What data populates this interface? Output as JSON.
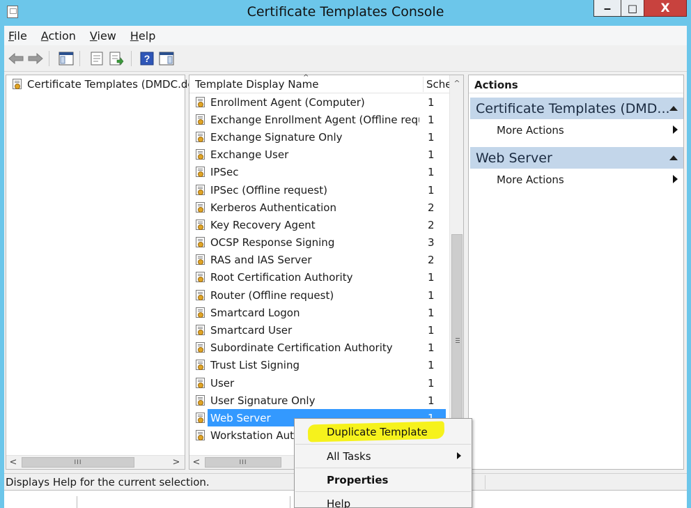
{
  "window": {
    "title": "Certificate Templates Console",
    "minimize_glyph": "‒",
    "maximize_glyph": "□",
    "close_glyph": "X"
  },
  "menubar": {
    "items": [
      {
        "first": "F",
        "rest": "ile"
      },
      {
        "first": "A",
        "rest": "ction"
      },
      {
        "first": "V",
        "rest": "iew"
      },
      {
        "first": "H",
        "rest": "elp"
      }
    ]
  },
  "toolbar": {
    "icons": [
      "back-arrow-icon",
      "forward-arrow-icon",
      "show-hide-console-tree-icon",
      "properties-icon",
      "export-list-icon",
      "help-icon",
      "show-hide-action-pane-icon"
    ],
    "colors": {
      "arrow": "#8c8c8c",
      "accent": "#2a4f8e",
      "help": "#2f56b8"
    }
  },
  "tree": {
    "root_label": "Certificate Templates (DMDC.de"
  },
  "list": {
    "columns": {
      "name": "Template Display Name",
      "schema": "Sche"
    },
    "rows": [
      {
        "name": "Enrollment Agent (Computer)",
        "schema": "1"
      },
      {
        "name": "Exchange Enrollment Agent (Offline requ...",
        "schema": "1"
      },
      {
        "name": "Exchange Signature Only",
        "schema": "1"
      },
      {
        "name": "Exchange User",
        "schema": "1"
      },
      {
        "name": "IPSec",
        "schema": "1"
      },
      {
        "name": "IPSec (Offline request)",
        "schema": "1"
      },
      {
        "name": "Kerberos Authentication",
        "schema": "2"
      },
      {
        "name": "Key Recovery Agent",
        "schema": "2"
      },
      {
        "name": "OCSP Response Signing",
        "schema": "3"
      },
      {
        "name": "RAS and IAS Server",
        "schema": "2"
      },
      {
        "name": "Root Certification Authority",
        "schema": "1"
      },
      {
        "name": "Router (Offline request)",
        "schema": "1"
      },
      {
        "name": "Smartcard Logon",
        "schema": "1"
      },
      {
        "name": "Smartcard User",
        "schema": "1"
      },
      {
        "name": "Subordinate Certification Authority",
        "schema": "1"
      },
      {
        "name": "Trust List Signing",
        "schema": "1"
      },
      {
        "name": "User",
        "schema": "1"
      },
      {
        "name": "User Signature Only",
        "schema": "1"
      },
      {
        "name": "Web Server",
        "schema": "1",
        "selected": true
      },
      {
        "name": "Workstation Auth",
        "schema": ""
      }
    ],
    "selection_color": "#3399ff"
  },
  "actions": {
    "title": "Actions",
    "sections": [
      {
        "header": "Certificate Templates (DMD...",
        "link": "More Actions"
      },
      {
        "header": "Web Server",
        "link": "More Actions"
      }
    ],
    "section_color": "#c3d6ea"
  },
  "status": {
    "text": "Displays Help for the current selection."
  },
  "context_menu": {
    "items": [
      {
        "label": "Duplicate Template",
        "highlighted": true
      },
      {
        "label": "All Tasks",
        "submenu": true
      },
      {
        "label": "Properties",
        "bold": true
      },
      {
        "label": "Help"
      }
    ],
    "highlight_color": "#f6f21c"
  },
  "scroll_glyphs": {
    "left": "<",
    "right": ">",
    "up": "^",
    "grip": "III"
  }
}
